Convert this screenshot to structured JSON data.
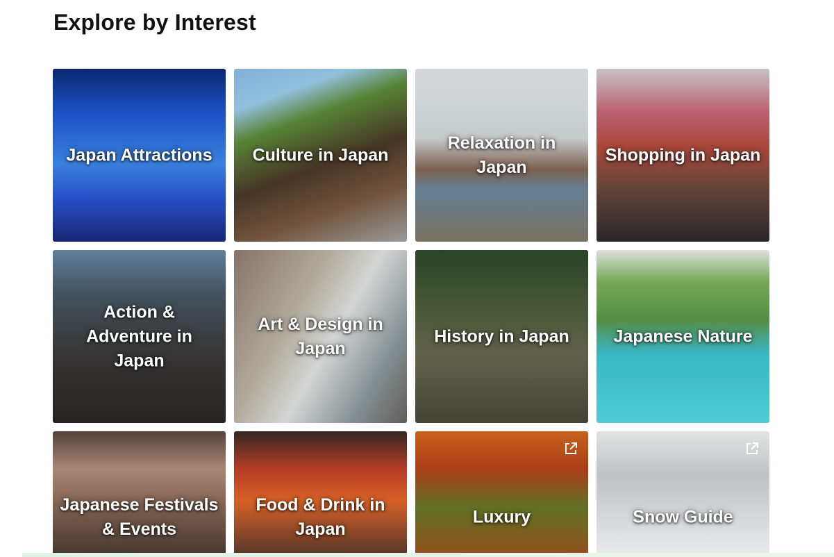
{
  "section": {
    "title": "Explore by Interest"
  },
  "tiles": [
    {
      "label": "Japan Attractions"
    },
    {
      "label": "Culture in Japan"
    },
    {
      "label": "Relaxation in Japan"
    },
    {
      "label": "Shopping in Japan"
    },
    {
      "label": "Action & Adventure in Japan"
    },
    {
      "label": "Art & Design in Japan"
    },
    {
      "label": "History in Japan"
    },
    {
      "label": "Japanese Nature"
    },
    {
      "label": "Japanese Festivals & Events"
    },
    {
      "label": "Food & Drink in Japan"
    },
    {
      "label": "Luxury",
      "icon": "external-link-icon"
    },
    {
      "label": "Snow Guide",
      "icon": "external-link-icon"
    }
  ],
  "colors": {
    "title": "#111111",
    "label": "#ffffff"
  }
}
